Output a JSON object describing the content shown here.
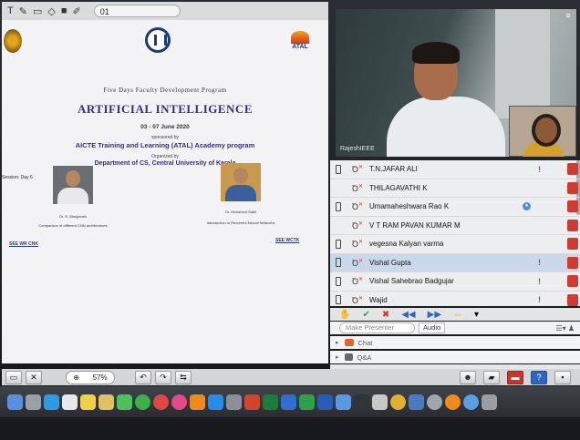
{
  "toolbar": {
    "page_field": "01",
    "tools": [
      {
        "icon": "text-tool-icon",
        "glyph": "T"
      },
      {
        "icon": "pen-tool-icon",
        "glyph": "✎"
      },
      {
        "icon": "shape-tool-icon",
        "glyph": "▭"
      },
      {
        "icon": "eraser-tool-icon",
        "glyph": "◇"
      },
      {
        "icon": "color-tool-icon",
        "glyph": "■"
      },
      {
        "icon": "pointer-tool-icon",
        "glyph": "✐"
      }
    ]
  },
  "slide": {
    "program_line": "Five Days Faculty Development Program",
    "title": "ARTIFICIAL INTELLIGENCE",
    "dates": "03 - 07 June 2020",
    "sponsored_by": "sponsored by",
    "program_name": "AICTE Training and Learning (ATAL) Academy program",
    "organized_by": "Organized by",
    "department": "Department of CS, Central University of Kerala",
    "session": "Session: Day 6",
    "atal_logo_text": "ATAL",
    "speaker1": {
      "name": "Dr. S. Manjunath",
      "topic": "Comparison of different CNN architectures",
      "link": "SEE WR CNK"
    },
    "speaker2": {
      "name": "Dr. Mohamed Sabil",
      "topic": "Introduction to Recurrent Neural Networks",
      "link": "SEE WCTK"
    }
  },
  "bottom_bar": {
    "zoom": "57%"
  },
  "video": {
    "speaker_name": "RajeshIEEE"
  },
  "participants": [
    {
      "name": "T.N.JAFAR ALI",
      "device": true,
      "flag": true,
      "badge": false,
      "selected": false
    },
    {
      "name": "THILAGAVATHI K",
      "device": false,
      "flag": false,
      "badge": false,
      "selected": false
    },
    {
      "name": "Umamaheshwara Rao K",
      "device": true,
      "flag": false,
      "badge": true,
      "selected": false
    },
    {
      "name": "V T RAM PAVAN KUMAR M",
      "device": false,
      "flag": false,
      "badge": false,
      "selected": false
    },
    {
      "name": "vegesna Kalyan varma",
      "device": true,
      "flag": false,
      "badge": false,
      "selected": false
    },
    {
      "name": "Vishal Gupta",
      "device": true,
      "flag": true,
      "badge": false,
      "selected": true
    },
    {
      "name": "Vishal Sahebrao Badgujar",
      "device": true,
      "flag": true,
      "badge": false,
      "selected": false
    },
    {
      "name": "Wajid",
      "device": true,
      "flag": true,
      "badge": false,
      "selected": false
    }
  ],
  "roles": {
    "make_presenter": "Make Presenter",
    "audio": "Audio"
  },
  "panels": {
    "chat": "Chat",
    "qa": "Q&A"
  },
  "dock_icons": [
    "finder-icon",
    "launchpad-icon",
    "safari-icon",
    "mail-icon",
    "notes-icon",
    "photos-icon",
    "messages-icon",
    "facetime-icon",
    "no-entry-icon",
    "itunes-icon",
    "books-icon",
    "app-store-icon",
    "system-preferences-icon",
    "powerpoint-icon",
    "excel-icon",
    "keynote-icon",
    "numbers-icon",
    "word-icon",
    "preview-icon",
    "terminal-icon",
    "script-icon",
    "chrome-icon",
    "gallery-icon",
    "camera-icon",
    "vlc-icon",
    "network-icon",
    "trash-icon"
  ]
}
